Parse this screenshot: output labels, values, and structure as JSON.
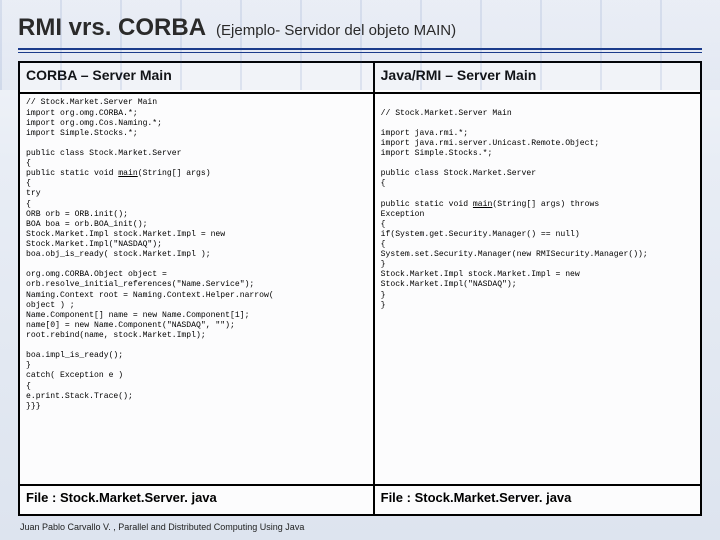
{
  "title": {
    "main": "RMI vrs. CORBA",
    "subtitle": "(Ejemplo- Servidor del objeto MAIN)"
  },
  "table": {
    "headers": {
      "left": "CORBA – Server Main",
      "right": "Java/RMI – Server Main"
    },
    "code": {
      "corba_pre": "// Stock.Market.Server Main\nimport org.omg.CORBA.*;\nimport org.omg.Cos.Naming.*;\nimport Simple.Stocks.*;\n\npublic class Stock.Market.Server\n{\npublic static void ",
      "corba_main": "main",
      "corba_post": "(String[] args)\n{\ntry\n{\nORB orb = ORB.init();\nBOA boa = orb.BOA_init();\nStock.Market.Impl stock.Market.Impl = new\nStock.Market.Impl(\"NASDAQ\");\nboa.obj_is_ready( stock.Market.Impl );\n\norg.omg.CORBA.Object object =\norb.resolve_initial_references(\"Name.Service\");\nNaming.Context root = Naming.Context.Helper.narrow(\nobject ) ;\nName.Component[] name = new Name.Component[1];\nname[0] = new Name.Component(\"NASDAQ\", \"\");\nroot.rebind(name, stock.Market.Impl);\n\nboa.impl_is_ready();\n}\ncatch( Exception e )\n{\ne.print.Stack.Trace();\n}}}",
      "rmi_pre": "\n// Stock.Market.Server Main\n\nimport java.rmi.*;\nimport java.rmi.server.Unicast.Remote.Object;\nimport Simple.Stocks.*;\n\npublic class Stock.Market.Server\n{\n\npublic static void ",
      "rmi_main": "main",
      "rmi_post": "(String[] args) throws\nException\n{\nif(System.get.Security.Manager() == null)\n{\nSystem.set.Security.Manager(new RMISecurity.Manager());\n}\nStock.Market.Impl stock.Market.Impl = new\nStock.Market.Impl(\"NASDAQ\");\n}\n}"
    },
    "files": {
      "left": "File : Stock.Market.Server. java",
      "right": "File : Stock.Market.Server. java"
    }
  },
  "footer": "Juan Pablo Carvallo V. , Parallel and Distributed Computing Using Java"
}
